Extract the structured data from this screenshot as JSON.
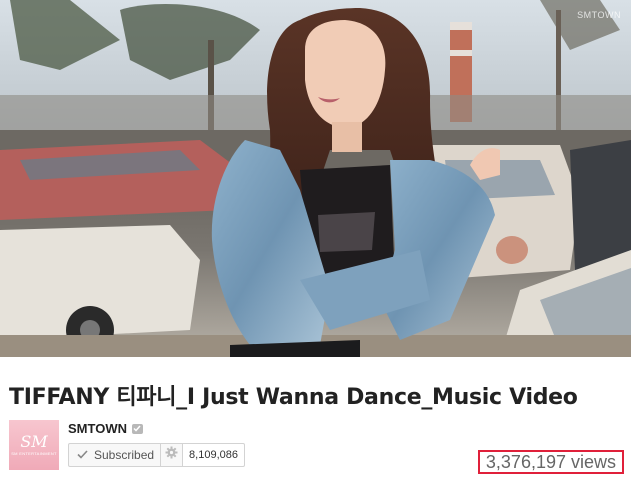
{
  "video": {
    "watermark": "SMTOWN"
  },
  "title": "TIFFANY 티파니_I Just Wanna Dance_Music Video",
  "channel": {
    "name": "SMTOWN",
    "avatar_text": "SM",
    "avatar_subtext": "SM ENTERTAINMENT",
    "verified_icon": "check-icon",
    "brand_color": "#f3b4c0"
  },
  "subscribe": {
    "label": "Subscribed",
    "check_icon": "check-icon",
    "settings_icon": "gear-icon",
    "count": "8,109,086"
  },
  "stats": {
    "views": "3,376,197 views",
    "highlight_color": "#e0203a"
  }
}
